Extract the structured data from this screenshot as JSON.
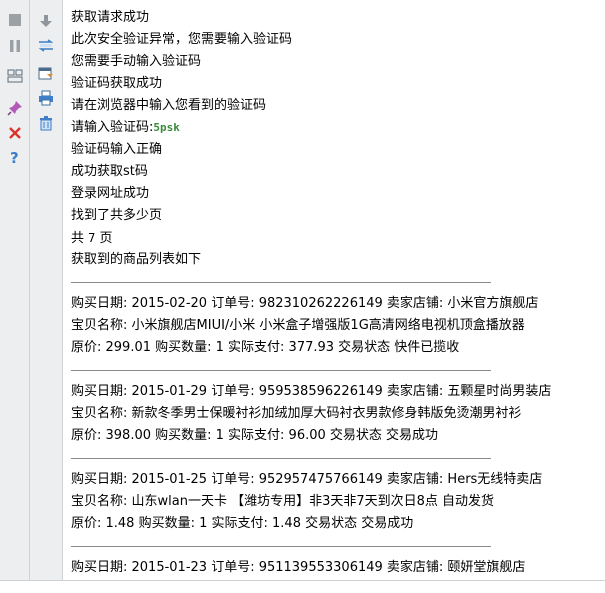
{
  "toolbar": {
    "left": [
      {
        "name": "stop-icon"
      },
      {
        "name": "pause-icon"
      },
      {
        "name": "layout-icon"
      },
      {
        "name": "pin-icon"
      },
      {
        "name": "close-icon"
      },
      {
        "name": "help-icon"
      }
    ],
    "mid": [
      {
        "name": "scroll-down-icon"
      },
      {
        "name": "wrap-icon"
      },
      {
        "name": "export-icon"
      },
      {
        "name": "print-icon"
      },
      {
        "name": "trash-icon"
      }
    ]
  },
  "console": {
    "status": [
      "获取请求成功",
      "此次安全验证异常，您需要输入验证码",
      "您需要手动输入验证码",
      "验证码获取成功",
      "请在浏览器中输入您看到的验证码"
    ],
    "captcha_prompt": "请输入验证码:",
    "captcha_value": "5psk",
    "after": [
      "验证码输入正确",
      "成功获取st码",
      "登录网址成功",
      "找到了共多少页"
    ],
    "pages_prefix": "共",
    "pages_count": "7",
    "pages_suffix": "页",
    "list_title": "获取到的商品列表如下",
    "orders": [
      {
        "l1": "购买日期: 2015-02-20 订单号: 982310262226149 卖家店铺: 小米官方旗舰店",
        "l2": "宝贝名称: 小米旗舰店MIUI/小米 小米盒子增强版1G高清网络电视机顶盒播放器",
        "l3": "原价: 299.01 购买数量: 1 实际支付: 377.93 交易状态 快件已揽收"
      },
      {
        "l1": "购买日期: 2015-01-29 订单号: 959538596226149 卖家店铺: 五颗星时尚男装店",
        "l2": "宝贝名称: 新款冬季男士保暖衬衫加绒加厚大码衬衣男款修身韩版免烫潮男衬衫",
        "l3": "原价: 398.00 购买数量: 1 实际支付: 96.00 交易状态 交易成功"
      },
      {
        "l1": "购买日期: 2015-01-25 订单号: 952957475766149 卖家店铺: Hers无线特卖店",
        "l2": "宝贝名称: 山东wlan一天卡 【潍坊专用】非3天非7天到次日8点 自动发货",
        "l3": "原价: 1.48 购买数量: 1 实际支付: 1.48 交易状态 交易成功"
      },
      {
        "l1": "购买日期: 2015-01-23 订单号: 951139553306149 卖家店铺: 颐妍堂旗舰店"
      }
    ]
  }
}
